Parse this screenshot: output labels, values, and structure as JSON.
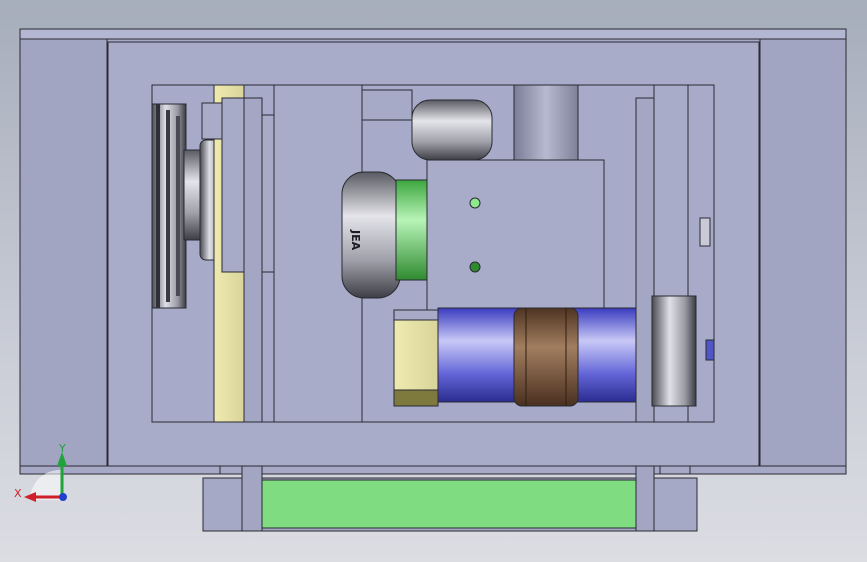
{
  "viewport": {
    "background_top": "#a6adbb",
    "background_bottom": "#dcdde3"
  },
  "part_label": "JEA",
  "triad": {
    "x_label": "X",
    "y_label": "Y",
    "x_color": "#d0202a",
    "y_color": "#1fa33a",
    "z_color": "#1e3fd0"
  },
  "colors": {
    "frame": "#a6a9c8",
    "frame_dark": "#9598b8",
    "green": "#7fdc80",
    "yellow": "#e8e6b0",
    "motor_blue": "#6b6fe0",
    "coupling_brown": "#7a5a40"
  }
}
